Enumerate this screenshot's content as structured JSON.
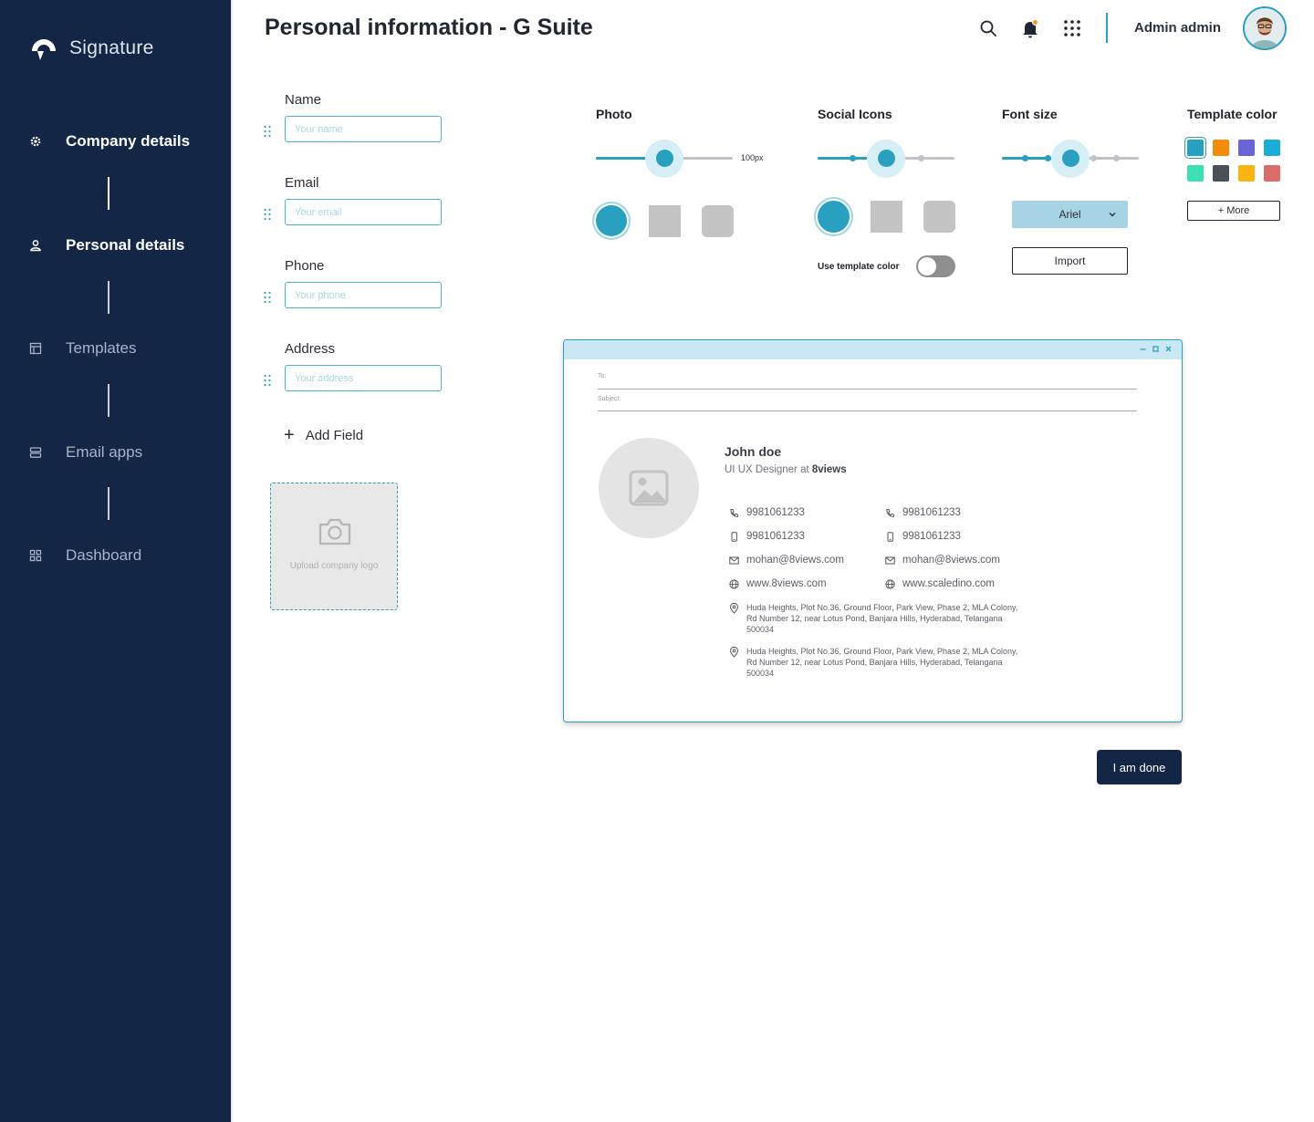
{
  "brand": {
    "name": "Signature",
    "logo_icon": "signature-logo-icon"
  },
  "sidebar": {
    "items": [
      {
        "label": "Company details",
        "icon": "gear-icon",
        "active": true
      },
      {
        "label": "Personal details",
        "icon": "user-icon",
        "active": true
      },
      {
        "label": "Templates",
        "icon": "template-icon",
        "active": false
      },
      {
        "label": "Email apps",
        "icon": "server-icon",
        "active": false
      },
      {
        "label": "Dashboard",
        "icon": "grid-icon",
        "active": false
      }
    ]
  },
  "header": {
    "title": "Personal information - G Suite",
    "admin_name": "Admin admin",
    "icons": [
      "search-icon",
      "bell-icon",
      "apps-icon"
    ],
    "notification_dot_color": "#f59a23"
  },
  "form": {
    "fields": [
      {
        "label": "Name",
        "placeholder": "Your name"
      },
      {
        "label": "Email",
        "placeholder": "Your email"
      },
      {
        "label": "Phone",
        "placeholder": "Your phone"
      },
      {
        "label": "Address",
        "placeholder": "Your address"
      }
    ],
    "add_field_label": "Add Field",
    "upload_logo_label": "Upload company logo"
  },
  "controls": {
    "photo": {
      "title": "Photo",
      "size_label": "100px",
      "level": 0.5,
      "shapes": [
        "circle",
        "square",
        "rounded"
      ],
      "selected_shape": "circle"
    },
    "social": {
      "title": "Social Icons",
      "level": 0.5,
      "steps": 5,
      "shapes": [
        "circle",
        "square",
        "rounded"
      ],
      "selected_shape": "circle",
      "use_template_label": "Use template color",
      "use_template_on": false
    },
    "font_size": {
      "title": "Font size",
      "level": 0.5,
      "steps": 7,
      "font_value": "Ariel",
      "import_label": "Import"
    },
    "template_color": {
      "title": "Template color",
      "colors": [
        "#2aa0c0",
        "#f58b0a",
        "#6b63d8",
        "#1aaed6",
        "#3de0b3",
        "#4a4f58",
        "#f9b40f",
        "#dc6b6b"
      ],
      "selected_index": 0,
      "more_label": "+ More"
    }
  },
  "accent_color": "#2aa0c0",
  "preview": {
    "to_label": "To:",
    "subject_label": "Subject:",
    "name": "John doe",
    "role_prefix": "UI UX Designer at ",
    "company": "8views",
    "columns": [
      {
        "phone": "9981061233",
        "mobile": "9981061233",
        "email": "mohan@8views.com",
        "website": "www.8views.com"
      },
      {
        "phone": "9981061233",
        "mobile": "9981061233",
        "email": "mohan@8views.com",
        "website": "www.scaledino.com"
      }
    ],
    "addresses": [
      "Huda Heights, Plot No.36, Ground Floor, Park View, Phase 2, MLA Colony, Rd Number 12, near Lotus Pond, Banjara Hills, Hyderabad, Telangana 500034",
      "Huda Heights, Plot No.36, Ground Floor, Park View, Phase 2, MLA Colony, Rd Number 12, near Lotus Pond, Banjara Hills, Hyderabad, Telangana 500034"
    ]
  },
  "done_label": "I am done"
}
